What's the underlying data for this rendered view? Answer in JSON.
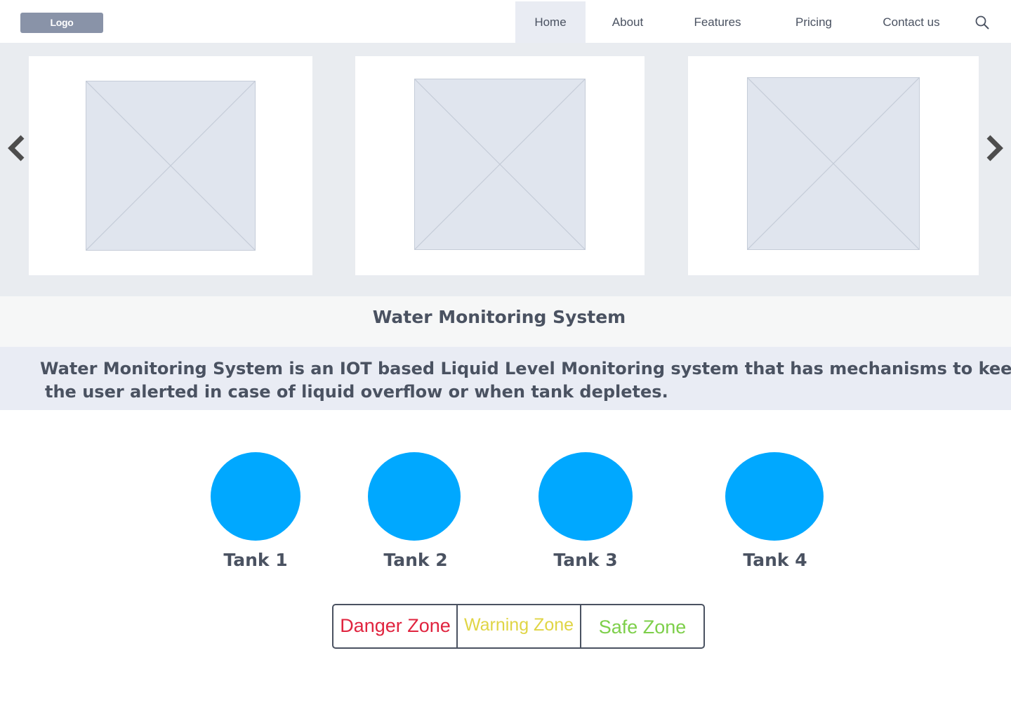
{
  "header": {
    "logo": "Logo",
    "nav": [
      "Home",
      "About",
      "Features",
      "Pricing",
      "Contact us"
    ],
    "active_nav": "Home",
    "search_icon": "search-icon"
  },
  "carousel": {
    "prev_icon": "chevron-left-icon",
    "next_icon": "chevron-right-icon",
    "slides": [
      {
        "image": "image-placeholder"
      },
      {
        "image": "image-placeholder"
      },
      {
        "image": "image-placeholder"
      }
    ]
  },
  "page": {
    "title": "Water Monitoring System",
    "description_line1": "Water Monitoring System is an IOT based Liquid Level Monitoring system that has mechanisms to keep",
    "description_line2": "the user alerted in case of liquid overflow or when tank depletes."
  },
  "tanks": [
    {
      "label": "Tank 1",
      "color": "#00a8ff"
    },
    {
      "label": "Tank 2",
      "color": "#00a8ff"
    },
    {
      "label": "Tank 3",
      "color": "#00a8ff"
    },
    {
      "label": "Tank 4",
      "color": "#00a8ff"
    }
  ],
  "legend": {
    "danger": {
      "label": "Danger Zone",
      "color": "#e0243f"
    },
    "warning": {
      "label": "Warning Zone",
      "color": "#e0d545"
    },
    "safe": {
      "label": "Safe Zone",
      "color": "#7dcf4a"
    }
  }
}
